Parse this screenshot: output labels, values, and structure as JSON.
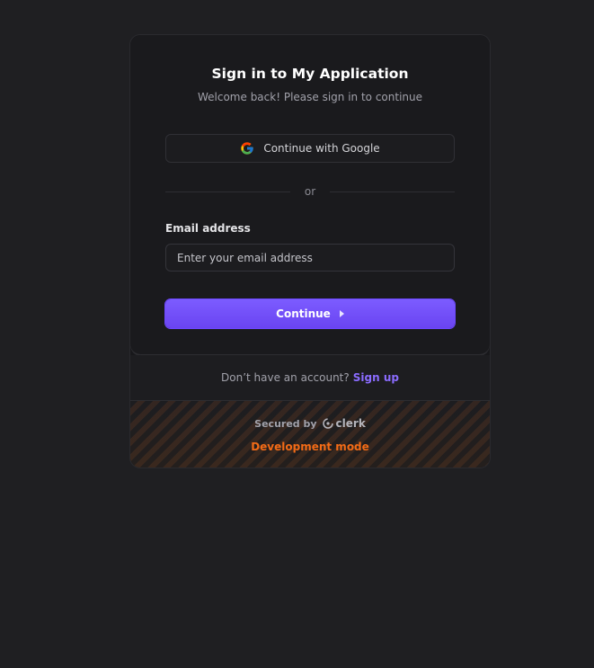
{
  "signin": {
    "title": "Sign in to My Application",
    "subtitle": "Welcome back! Please sign in to continue",
    "google_button_label": "Continue with Google",
    "divider_text": "or",
    "email_label": "Email address",
    "email_placeholder": "Enter your email address",
    "email_value": "",
    "continue_label": "Continue"
  },
  "signup": {
    "prompt": "Don’t have an account?",
    "link_label": "Sign up"
  },
  "footer": {
    "secured_by": "Secured by",
    "brand_name": "clerk",
    "dev_mode": "Development mode"
  },
  "colors": {
    "accent": "#6c47ff",
    "dev_mode": "#f36b16",
    "background": "#1f1f22"
  },
  "icons": {
    "google": "google-icon",
    "continue": "caret-right-icon",
    "clerk": "clerk-logo-icon"
  }
}
